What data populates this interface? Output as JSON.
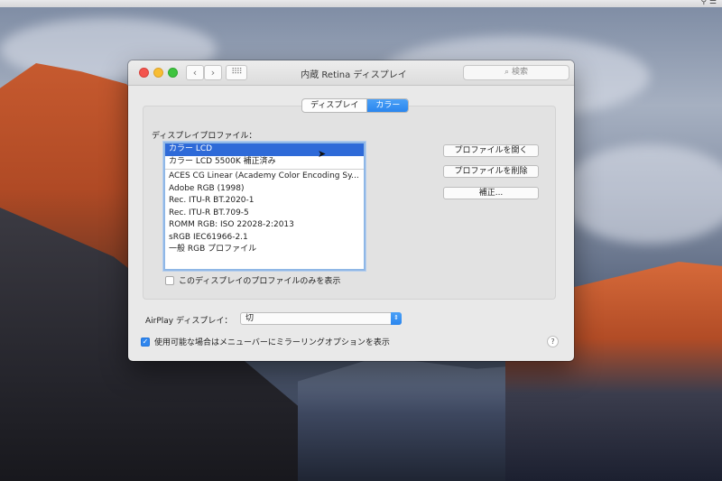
{
  "window": {
    "title": "内蔵 Retina ディスプレイ",
    "search_placeholder": "検索",
    "grid_icon": "grid-icon"
  },
  "tabs": [
    {
      "label": "ディスプレイ",
      "active": false
    },
    {
      "label": "カラー",
      "active": true
    }
  ],
  "profiles": {
    "label": "ディスプレイプロファイル：",
    "selected": "カラー LCD",
    "group_top": [
      "カラー LCD",
      "カラー LCD 5500K 補正済み"
    ],
    "group_bottom": [
      "ACES CG Linear (Academy Color Encoding Sy...",
      "Adobe RGB (1998)",
      "Rec. ITU-R BT.2020-1",
      "Rec. ITU-R BT.709-5",
      "ROMM RGB: ISO 22028-2:2013",
      "sRGB IEC61966-2.1",
      "一般 RGB プロファイル"
    ],
    "only_this_display": "このディスプレイのプロファイルのみを表示",
    "only_this_display_checked": false
  },
  "buttons": {
    "open": "プロファイルを開く",
    "delete": "プロファイルを削除",
    "calibrate": "補正..."
  },
  "airplay": {
    "label": "AirPlay ディスプレイ：",
    "value": "切"
  },
  "mirror": {
    "label": "使用可能な場合はメニューバーにミラーリングオプションを表示",
    "checked": true
  },
  "colors": {
    "accent": "#2f86ee",
    "selection": "#2e6ad8"
  }
}
